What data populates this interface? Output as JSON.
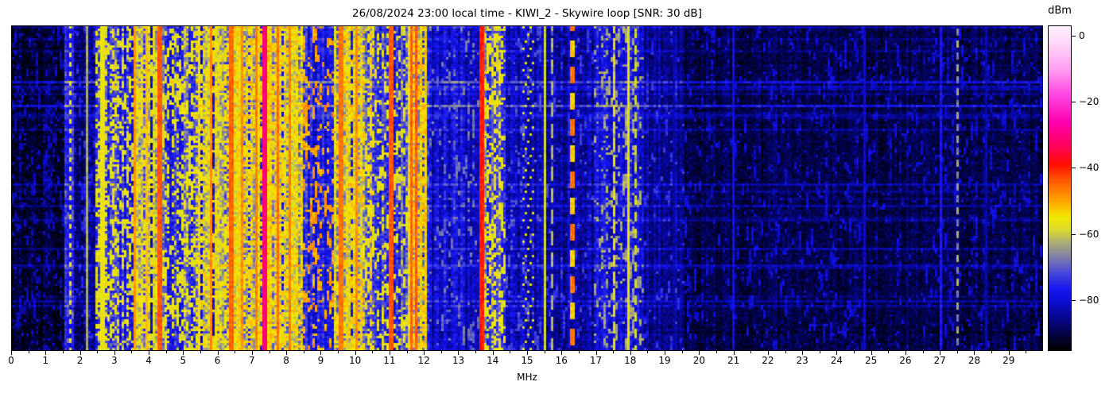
{
  "header": {
    "title": "26/08/2024 23:00 local time - KIWI_2 - Skywire loop [SNR: 30 dB]"
  },
  "chart_data": {
    "type": "heatmap",
    "title": "26/08/2024 23:00 local time - KIWI_2 - Skywire loop [SNR: 30 dB]",
    "xlabel": "MHz",
    "value_label": "dBm",
    "x_range": [
      0,
      30
    ],
    "x_major_ticks": [
      "0",
      "1",
      "2",
      "3",
      "4",
      "5",
      "6",
      "7",
      "8",
      "9",
      "10",
      "11",
      "12",
      "13",
      "14",
      "15",
      "16",
      "17",
      "18",
      "19",
      "20",
      "21",
      "22",
      "23",
      "24",
      "25",
      "26",
      "27",
      "28",
      "29"
    ],
    "x_minor_tick_step": 0.5,
    "value_range": [
      -95.5,
      3.2
    ],
    "colorbar_ticks": [
      {
        "value": 0,
        "label": "0"
      },
      {
        "value": -20,
        "label": "−20"
      },
      {
        "value": -40,
        "label": "−40"
      },
      {
        "value": -60,
        "label": "−60"
      },
      {
        "value": -80,
        "label": "−80"
      }
    ],
    "legend_position": "right-colorbar",
    "grid": false,
    "colormap_stops": [
      [
        -95.5,
        "#000000"
      ],
      [
        -91,
        "#03033e"
      ],
      [
        -86,
        "#070788"
      ],
      [
        -81,
        "#0d0dcf"
      ],
      [
        -77,
        "#1717f0"
      ],
      [
        -72,
        "#4747d8"
      ],
      [
        -67,
        "#8080a8"
      ],
      [
        -63,
        "#a8a878"
      ],
      [
        -59,
        "#d8d830"
      ],
      [
        -55,
        "#f2e800"
      ],
      [
        -50,
        "#ffa300"
      ],
      [
        -44,
        "#ff5a00"
      ],
      [
        -39,
        "#ff0f00"
      ],
      [
        -33,
        "#ff0060"
      ],
      [
        -26,
        "#ff00b0"
      ],
      [
        -18,
        "#ff44e2"
      ],
      [
        -10,
        "#ff9ef2"
      ],
      [
        -2,
        "#ffd7f8"
      ],
      [
        3.2,
        "#fdf0fd"
      ]
    ],
    "rows": 136,
    "cols": 432,
    "seed": 42,
    "noise_bands": [
      {
        "f0": 0.0,
        "f1": 1.52,
        "base": -92,
        "col_var": 2,
        "cell_var": 3,
        "speckle_p": 0.1,
        "speckle_level": -83,
        "gap_p": 0
      },
      {
        "f0": 1.52,
        "f1": 1.78,
        "base": -77,
        "col_var": 2,
        "cell_var": 3,
        "speckle_p": 0.05,
        "speckle_level": -70,
        "gap_p": 0
      },
      {
        "f0": 1.78,
        "f1": 2.42,
        "base": -87,
        "col_var": 3,
        "cell_var": 4,
        "speckle_p": 0.08,
        "speckle_level": -76,
        "gap_p": 0
      },
      {
        "f0": 2.42,
        "f1": 3.05,
        "base": -72,
        "col_var": 5,
        "cell_var": 5,
        "speckle_p": 0.38,
        "speckle_level": -57,
        "gap_p": 0
      },
      {
        "f0": 3.05,
        "f1": 3.55,
        "base": -74,
        "col_var": 6,
        "cell_var": 5,
        "speckle_p": 0.25,
        "speckle_level": -58,
        "gap_p": 0
      },
      {
        "f0": 3.55,
        "f1": 4.25,
        "base": -66,
        "col_var": 6,
        "cell_var": 5,
        "speckle_p": 0.4,
        "speckle_level": -56,
        "gap_p": 0.1
      },
      {
        "f0": 4.25,
        "f1": 5.35,
        "base": -73,
        "col_var": 6,
        "cell_var": 5,
        "speckle_p": 0.3,
        "speckle_level": -57,
        "gap_p": 0
      },
      {
        "f0": 5.35,
        "f1": 6.3,
        "base": -66,
        "col_var": 6,
        "cell_var": 5,
        "speckle_p": 0.45,
        "speckle_level": -55,
        "gap_p": 0.1
      },
      {
        "f0": 6.3,
        "f1": 8.45,
        "base": -61,
        "col_var": 7,
        "cell_var": 5,
        "speckle_p": 0.5,
        "speckle_level": -54,
        "gap_p": 0.13
      },
      {
        "f0": 8.45,
        "f1": 9.35,
        "base": -77,
        "col_var": 4,
        "cell_var": 4,
        "speckle_p": 0.12,
        "speckle_level": -50,
        "gap_p": 0
      },
      {
        "f0": 9.35,
        "f1": 10.3,
        "base": -64,
        "col_var": 6,
        "cell_var": 5,
        "speckle_p": 0.4,
        "speckle_level": -54,
        "gap_p": 0.12
      },
      {
        "f0": 10.3,
        "f1": 11.15,
        "base": -74,
        "col_var": 5,
        "cell_var": 5,
        "speckle_p": 0.25,
        "speckle_level": -57,
        "gap_p": 0
      },
      {
        "f0": 11.15,
        "f1": 11.5,
        "base": -73,
        "col_var": 5,
        "cell_var": 5,
        "speckle_p": 0.2,
        "speckle_level": -58,
        "gap_p": 0
      },
      {
        "f0": 11.5,
        "f1": 12.07,
        "base": -62,
        "col_var": 6,
        "cell_var": 5,
        "speckle_p": 0.45,
        "speckle_level": -53,
        "gap_p": 0.1
      },
      {
        "f0": 12.07,
        "f1": 13.63,
        "base": -81,
        "col_var": 4,
        "cell_var": 4,
        "speckle_p": 0.07,
        "speckle_level": -69,
        "gap_p": 0
      },
      {
        "f0": 13.63,
        "f1": 13.8,
        "base": -66,
        "col_var": 3,
        "cell_var": 4,
        "speckle_p": 0.3,
        "speckle_level": -55,
        "gap_p": 0
      },
      {
        "f0": 13.8,
        "f1": 14.35,
        "base": -73,
        "col_var": 4,
        "cell_var": 4,
        "speckle_p": 0.28,
        "speckle_level": -57,
        "gap_p": 0
      },
      {
        "f0": 14.35,
        "f1": 15.45,
        "base": -83,
        "col_var": 3,
        "cell_var": 4,
        "speckle_p": 0.05,
        "speckle_level": -72,
        "gap_p": 0
      },
      {
        "f0": 15.45,
        "f1": 16.95,
        "base": -84,
        "col_var": 3,
        "cell_var": 4,
        "speckle_p": 0.04,
        "speckle_level": -74,
        "gap_p": 0
      },
      {
        "f0": 16.95,
        "f1": 18.4,
        "base": -80,
        "col_var": 4,
        "cell_var": 4,
        "speckle_p": 0.1,
        "speckle_level": -64,
        "gap_p": 0
      },
      {
        "f0": 18.4,
        "f1": 19.55,
        "base": -85,
        "col_var": 3,
        "cell_var": 3,
        "speckle_p": 0.04,
        "speckle_level": -75,
        "gap_p": 0
      },
      {
        "f0": 19.55,
        "f1": 30.0,
        "base": -90,
        "col_var": 2,
        "cell_var": 3,
        "speckle_p": 0.05,
        "speckle_level": -81,
        "gap_p": 0
      }
    ],
    "signal_stripes": [
      {
        "f": 1.69,
        "bins": 1,
        "level": -57,
        "dash": [
          2,
          2
        ]
      },
      {
        "f": 2.16,
        "bins": 1,
        "level": -63
      },
      {
        "f": 2.62,
        "bins": 2,
        "level": -56
      },
      {
        "f": 3.6,
        "bins": 1,
        "level": -49
      },
      {
        "f": 3.94,
        "bins": 1,
        "level": -52
      },
      {
        "f": 4.33,
        "bins": 2,
        "level": -44
      },
      {
        "f": 5.8,
        "bins": 1,
        "level": -48
      },
      {
        "f": 6.37,
        "bins": 2,
        "level": -45
      },
      {
        "f": 6.7,
        "bins": 1,
        "level": -48
      },
      {
        "f": 7.15,
        "bins": 1,
        "level": -47
      },
      {
        "f": 7.37,
        "bins": 2,
        "level": -31
      },
      {
        "f": 7.76,
        "bins": 1,
        "level": -46
      },
      {
        "f": 8.1,
        "bins": 1,
        "level": -47
      },
      {
        "f": 9.57,
        "bins": 2,
        "level": -46
      },
      {
        "f": 10.02,
        "bins": 1,
        "level": -48
      },
      {
        "f": 10.47,
        "bins": 1,
        "level": -53,
        "dash": [
          3,
          2
        ]
      },
      {
        "f": 11.03,
        "bins": 2,
        "level": -44
      },
      {
        "f": 11.62,
        "bins": 1,
        "level": -45
      },
      {
        "f": 11.78,
        "bins": 1,
        "level": -44
      },
      {
        "f": 13.71,
        "bins": 2,
        "level": -40
      },
      {
        "f": 14.05,
        "bins": 1,
        "level": -55,
        "dash": [
          2,
          2
        ]
      },
      {
        "f": 15.52,
        "bins": 1,
        "level": -59
      },
      {
        "f": 15.75,
        "bins": 1,
        "level": -62,
        "dash": [
          6,
          3
        ]
      },
      {
        "f": 16.33,
        "bins": 2,
        "level": -46,
        "dash": [
          7,
          4
        ],
        "alt_level": -53
      },
      {
        "f": 17.55,
        "bins": 1,
        "level": -58,
        "dash": [
          5,
          2
        ]
      },
      {
        "f": 17.92,
        "bins": 1,
        "level": -57
      },
      {
        "f": 18.15,
        "bins": 1,
        "level": -59,
        "dash": [
          4,
          3
        ]
      },
      {
        "f": 19.25,
        "bins": 1,
        "level": -84
      },
      {
        "f": 21.02,
        "bins": 1,
        "level": -79
      },
      {
        "f": 24.8,
        "bins": 1,
        "level": -81
      },
      {
        "f": 27.07,
        "bins": 1,
        "level": -77
      },
      {
        "f": 27.52,
        "bins": 1,
        "level": -63,
        "dash": [
          3,
          2
        ],
        "alt_level": -67
      },
      {
        "f": 28.4,
        "bins": 1,
        "level": -83
      }
    ],
    "zigzag_signal": {
      "f_start": 14.85,
      "f_end": 15.16,
      "level": -58,
      "row_period": 9,
      "run": 1,
      "col_slope": 3
    },
    "row_streaks": {
      "bright": 26,
      "bright_boost": [
        2.5,
        7.5
      ],
      "dark": 8,
      "dark_boost": [
        -4,
        -2
      ]
    }
  }
}
